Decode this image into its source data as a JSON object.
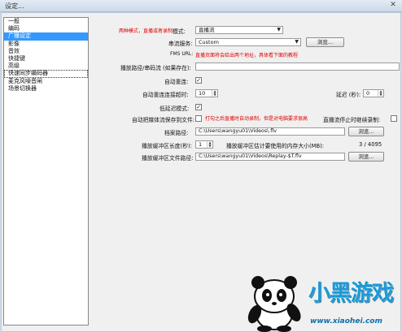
{
  "window": {
    "title": "设定..."
  },
  "sidebar": {
    "items": [
      {
        "label": "一般"
      },
      {
        "label": "编码"
      },
      {
        "label": "广播设定",
        "selected": true
      },
      {
        "label": "影像"
      },
      {
        "label": "音效"
      },
      {
        "label": "快捷键"
      },
      {
        "label": "高级"
      },
      {
        "label": "快速同步编码器",
        "focused": true
      },
      {
        "label": "麦克风噪音闸"
      },
      {
        "label": "场景切换器"
      }
    ]
  },
  "form": {
    "mode_note": "两种模式，直播或者录制",
    "mode_label": "模式:",
    "mode_value": "直播流",
    "service_label": "串流服务:",
    "service_value": "Custom",
    "browse_label": "浏览...",
    "fms_label": "FMS URL:",
    "fms_note": "直播页面将会给出两个地址，具体看下面的教程",
    "playpath_label": "播放路径/串码流 (如果存在):",
    "playpath_value": "",
    "autoreconnect_label": "自动重连:",
    "autoreconnect_checked": true,
    "timeout_label": "自动重连连接超时:",
    "timeout_value": "10",
    "delay_label": "延迟 (秒):",
    "delay_value": "0",
    "lowlatency_label": "低延迟模式:",
    "lowlatency_checked": true,
    "autosave_label": "自动把媒体流保存到文件:",
    "autosave_checked": false,
    "autosave_note": "打勾之后直播时自动录制，但是对电脑要求很高",
    "keeprecording_label": "直播流停止时继续录制:",
    "keeprecording_checked": false,
    "filepath_label": "档案路径:",
    "filepath_value": "C:\\Users\\wangyu01\\Videos\\.flv",
    "replaylength_label": "播放缓冲区长度(秒):",
    "replaylength_value": "1",
    "memory_label": "播放缓冲区估计要使用的内存大小(MB):",
    "memory_value": "3 / 4095",
    "replaypath_label": "播放缓冲区文件路径:",
    "replaypath_value": "C:\\Users\\wangyu01\\Videos\\Replay-$T.flv"
  },
  "watermark": {
    "brand_text": "小黑游戏",
    "url": "www.xiaohei.com"
  },
  "colors": {
    "note_red": "#e00000",
    "selection_blue": "#3399ff",
    "logo_blue": "#1a9ad6"
  }
}
